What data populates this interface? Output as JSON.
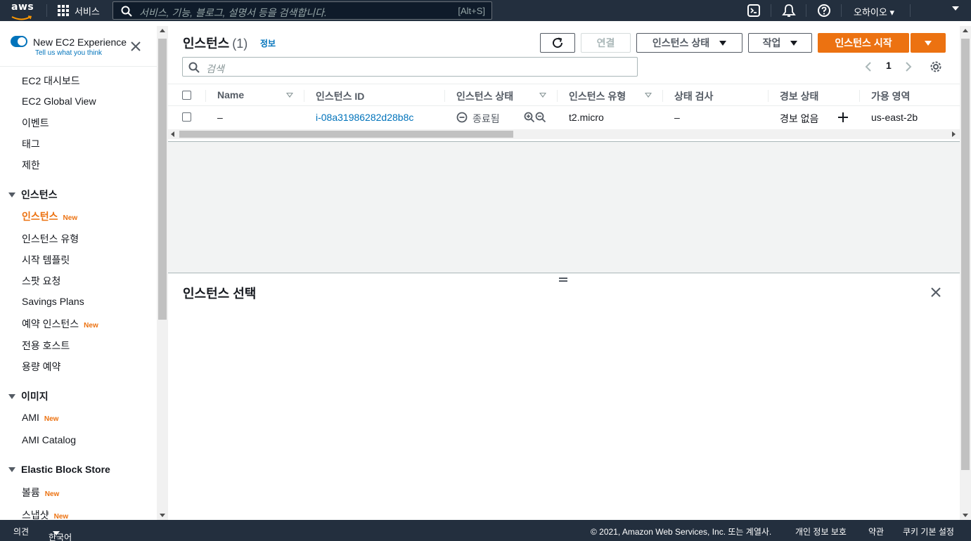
{
  "header": {
    "logo_text": "aws",
    "services_label": "서비스",
    "search_placeholder": "서비스, 기능, 블로그, 설명서 등을 검색합니다.",
    "search_shortcut": "[Alt+S]",
    "region": "오하이오 ▾"
  },
  "sidebar": {
    "experience_title": "New EC2 Experience",
    "experience_subtitle": "Tell us what you think",
    "new_badge": "New",
    "top_items": [
      "EC2 대시보드",
      "EC2 Global View",
      "이벤트",
      "태그",
      "제한"
    ],
    "sections": [
      {
        "label": "인스턴스",
        "items": [
          "인스턴스",
          "인스턴스 유형",
          "시작 템플릿",
          "스팟 요청",
          "Savings Plans",
          "예약 인스턴스",
          "전용 호스트",
          "용량 예약"
        ]
      },
      {
        "label": "이미지",
        "items": [
          "AMI",
          "AMI Catalog"
        ]
      },
      {
        "label": "Elastic Block Store",
        "items": [
          "볼륨",
          "스냅샷"
        ]
      }
    ]
  },
  "main": {
    "title": "인스턴스",
    "count": "(1)",
    "info_link": "정보",
    "buttons": {
      "connect": "연결",
      "instance_state": "인스턴스 상태",
      "actions": "작업",
      "launch": "인스턴스 시작"
    },
    "search_placeholder": "검색",
    "page_number": "1",
    "columns": [
      "Name",
      "인스턴스 ID",
      "인스턴스 상태",
      "인스턴스 유형",
      "상태 검사",
      "경보 상태",
      "가용 영역"
    ],
    "rows": [
      {
        "name": "–",
        "instance_id": "i-08a31986282d28b8c",
        "state": "종료됨",
        "type": "t2.micro",
        "status_check": "–",
        "alarm": "경보 없음",
        "zone": "us-east-2b"
      }
    ],
    "detail_title": "인스턴스 선택"
  },
  "footer": {
    "feedback": "의견",
    "language": "한국어",
    "copyright": "© 2021, Amazon Web Services, Inc. 또는 계열사.",
    "privacy": "개인 정보 보호",
    "terms": "약관",
    "cookies": "쿠키 기본 설정"
  },
  "colors": {
    "nav_bg": "#232f3e",
    "accent_orange": "#ec7211",
    "link_blue": "#0073bb"
  }
}
